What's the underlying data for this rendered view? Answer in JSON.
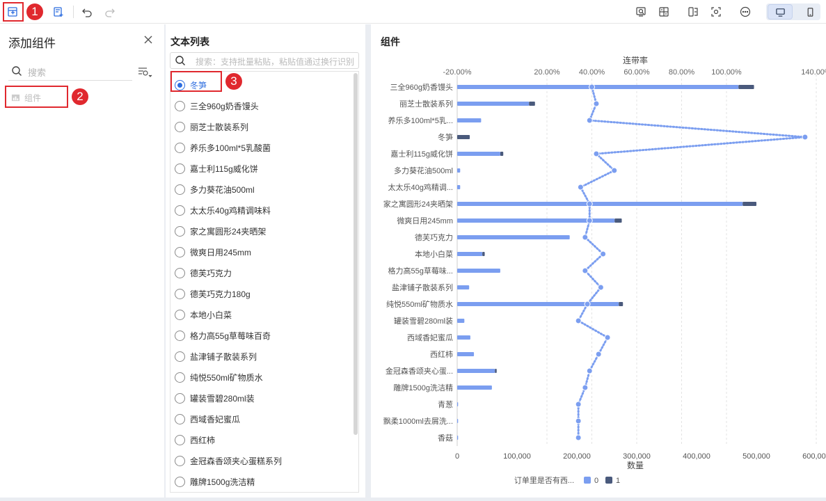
{
  "toolbar": {
    "icons": [
      "add-component-icon",
      "add-filter-icon",
      "undo-icon",
      "redo-icon",
      "preview-icon",
      "layout-icon",
      "split-icon",
      "screenshot-icon",
      "more-icon",
      "desktop-icon",
      "mobile-icon"
    ]
  },
  "annotations": [
    "1",
    "2",
    "3"
  ],
  "left_panel": {
    "title": "添加组件",
    "search_placeholder": "搜索",
    "component_item": "组件"
  },
  "mid_panel": {
    "title": "文本列表",
    "search_placeholder": "搜索：支持批量粘贴，粘贴值通过换行识别",
    "items": [
      {
        "label": "冬笋",
        "selected": true
      },
      {
        "label": "三全960g奶香馒头",
        "selected": false
      },
      {
        "label": "丽芝士散装系列",
        "selected": false
      },
      {
        "label": "养乐多100ml*5乳酸菌",
        "selected": false
      },
      {
        "label": "嘉士利115g威化饼",
        "selected": false
      },
      {
        "label": "多力葵花油500ml",
        "selected": false
      },
      {
        "label": "太太乐40g鸡精调味料",
        "selected": false
      },
      {
        "label": "家之寓圆形24夹晒架",
        "selected": false
      },
      {
        "label": "微爽日用245mm",
        "selected": false
      },
      {
        "label": "德芙巧克力",
        "selected": false
      },
      {
        "label": "德芙巧克力180g",
        "selected": false
      },
      {
        "label": "本地小白菜",
        "selected": false
      },
      {
        "label": "格力高55g草莓味百奇",
        "selected": false
      },
      {
        "label": "盐津铺子散装系列",
        "selected": false
      },
      {
        "label": "纯悦550ml矿物质水",
        "selected": false
      },
      {
        "label": "罐装雪碧280ml装",
        "selected": false
      },
      {
        "label": "西域香妃蜜瓜",
        "selected": false
      },
      {
        "label": "西红柿",
        "selected": false
      },
      {
        "label": "金冠森香颂夹心蛋糕系列",
        "selected": false
      },
      {
        "label": "雕牌1500g洗洁精",
        "selected": false
      }
    ]
  },
  "right_panel": {
    "title": "组件"
  },
  "chart_data": {
    "type": "bar",
    "orientation": "horizontal",
    "stacked": true,
    "categories": [
      "三全960g奶香馒头",
      "丽芝士散装系列",
      "养乐多100ml*5乳...",
      "冬笋",
      "嘉士利115g威化饼",
      "多力葵花油500ml",
      "太太乐40g鸡精调...",
      "家之寓圆形24夹晒架",
      "微爽日用245mm",
      "德芙巧克力",
      "本地小白菜",
      "格力高55g草莓味...",
      "盐津铺子散装系列",
      "纯悦550ml矿物质水",
      "罐装雪碧280ml装",
      "西域香妃蜜瓜",
      "西红柿",
      "金冠森香颂夹心蛋...",
      "雕牌1500g洗洁精",
      "青葱",
      "飘柔1000ml去屑洗...",
      "香菇"
    ],
    "series": [
      {
        "name": "0",
        "color": "#7b9ef0",
        "values": [
          470000,
          120000,
          40000,
          0,
          72000,
          5000,
          5000,
          477000,
          263000,
          188000,
          42000,
          72000,
          20000,
          270000,
          12000,
          22000,
          28000,
          63000,
          58000,
          1500,
          1500,
          1500
        ]
      },
      {
        "name": "1",
        "color": "#4a5a7c",
        "values": [
          26000,
          10000,
          0,
          21000,
          5000,
          0,
          0,
          23000,
          12000,
          0,
          4000,
          0,
          0,
          7000,
          0,
          0,
          0,
          3000,
          0,
          0,
          0,
          0
        ]
      }
    ],
    "line": {
      "name": "连带率",
      "color": "#7b9ef0",
      "style": "dotted",
      "values": [
        0.4,
        0.42,
        0.39,
        1.35,
        0.42,
        0.5,
        0.35,
        0.39,
        0.39,
        0.37,
        0.45,
        0.37,
        0.44,
        0.38,
        0.34,
        0.47,
        0.43,
        0.39,
        0.37,
        0.34,
        0.34,
        0.34
      ]
    },
    "xlabel": "数量",
    "x_ticks": [
      "0",
      "100,000",
      "200,000",
      "300,000",
      "400,000",
      "500,000",
      "600,000"
    ],
    "xlim": [
      0,
      600000
    ],
    "x2label": "连带率",
    "x2_ticks": [
      "-20.00%",
      "20.00%",
      "40.00%",
      "60.00%",
      "80.00%",
      "100.00%",
      "140.00%"
    ],
    "x2lim": [
      -0.2,
      1.4
    ],
    "legend_title": "订单里是否有西...",
    "legend_position": "bottom-center",
    "grid": true
  }
}
